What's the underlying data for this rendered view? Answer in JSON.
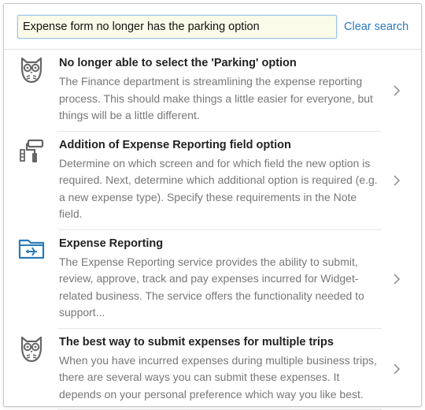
{
  "search": {
    "value": "Expense form no longer has the parking option",
    "clear_label": "Clear search"
  },
  "results": [
    {
      "icon": "owl-icon",
      "title": "No longer able to select the 'Parking' option",
      "description": "The Finance department is streamlining the expense reporting process. This should make things a little easier for everyone, but things will be a little different."
    },
    {
      "icon": "paint-roller-icon",
      "title": "Addition of Expense Reporting field option",
      "description": "Determine on which screen and for which field the new option is required. Next, determine which additional option is required (e.g. a new expense type). Specify these requirements in the Note field."
    },
    {
      "icon": "airplane-folder-icon",
      "title": "Expense Reporting",
      "description": "The Expense Reporting service provides the ability to submit, review, approve, track and pay expenses incurred for Widget-related business. The service offers the functionality needed to support..."
    },
    {
      "icon": "owl-icon",
      "title": "The best way to submit expenses for multiple trips",
      "description": "When you have incurred expenses during multiple business trips, there are several ways you can submit these expenses. It depends on your personal preference which way you like best."
    }
  ],
  "colors": {
    "link": "#2b7bbf",
    "icon_gray": "#666666",
    "icon_blue": "#2a7ab8",
    "input_bg": "#fbfbe9"
  }
}
